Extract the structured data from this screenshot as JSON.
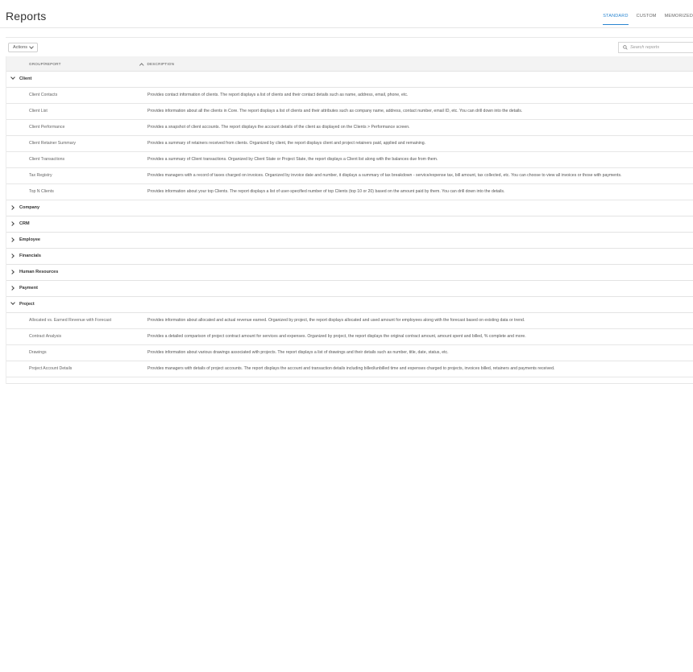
{
  "page": {
    "title": "Reports",
    "tabs": [
      {
        "label": "STANDARD",
        "active": true
      },
      {
        "label": "CUSTOM",
        "active": false
      },
      {
        "label": "MEMORIZED",
        "active": false
      }
    ]
  },
  "toolbar": {
    "actions_label": "Actions",
    "search_placeholder": "Search reports"
  },
  "table": {
    "columns": {
      "group_report": "GROUP/REPORT",
      "description": "DESCRIPTION"
    },
    "groups": [
      {
        "name": "Client",
        "expanded": true,
        "reports": [
          {
            "name": "Client Contacts",
            "description": "Provides contact information of clients. The report displays a list of clients and their contact details such as name, address, email, phone, etc."
          },
          {
            "name": "Client List",
            "description": "Provides information about all the clients in Core. The report displays a list of clients and their attributes such as company name, address, contact number, email ID, etc. You can drill down into the details."
          },
          {
            "name": "Client Performance",
            "description": "Provides a snapshot of client accounts. The report displays the account details of the client as displayed on the Clients > Performance screen."
          },
          {
            "name": "Client Retainer Summary",
            "description": "Provides a summary of retainers received from clients. Organized by client, the report displays client and project retainers paid, applied and remaining."
          },
          {
            "name": "Client Transactions",
            "description": "Provides a summary of Client transactions. Organized by Client State or Project State, the report displays a Client list along with the balances due from them."
          },
          {
            "name": "Tax Registry",
            "description": "Provides managers with a record of taxes charged on invoices. Organized by invoice date and number, it displays a summary of tax breakdown - service/expense tax, bill amount, tax collected, etc. You can choose to view all invoices or those with payments."
          },
          {
            "name": "Top N Clients",
            "description": "Provides information about your top Clients. The report displays a list of user-specified number of top Clients (top 10 or 20) based on the amount paid by them. You can drill down into the details."
          }
        ]
      },
      {
        "name": "Company",
        "expanded": false,
        "reports": []
      },
      {
        "name": "CRM",
        "expanded": false,
        "reports": []
      },
      {
        "name": "Employee",
        "expanded": false,
        "reports": []
      },
      {
        "name": "Financials",
        "expanded": false,
        "reports": []
      },
      {
        "name": "Human Resources",
        "expanded": false,
        "reports": []
      },
      {
        "name": "Payment",
        "expanded": false,
        "reports": []
      },
      {
        "name": "Project",
        "expanded": true,
        "reports": [
          {
            "name": "Allocated vs. Earned Revenue with Forecast",
            "description": "Provides information about allocated and actual revenue earned. Organized by project, the report displays allocated and used amount for employees along with the forecast based on existing data or trend."
          },
          {
            "name": "Contract Analysis",
            "description": "Provides a detailed comparison of project contract amount for services and expenses. Organized by project, the report displays the original contract amount, amount spent and billed, % complete and more."
          },
          {
            "name": "Drawings",
            "description": "Provides information about various drawings associated with projects. The report displays a list of drawings and their details such as number, title, date, status, etc."
          },
          {
            "name": "Project Account Details",
            "description": "Provides managers with details of project accounts. The report displays the account and transaction details including billed/unbilled time and expenses charged to projects, invoices billed, retainers and payments received."
          }
        ]
      }
    ]
  }
}
